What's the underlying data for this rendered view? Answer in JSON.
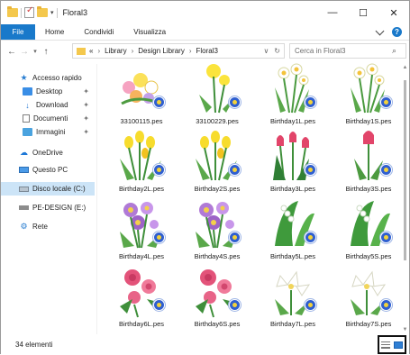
{
  "window": {
    "title": "Floral3",
    "controls": {
      "minimize": "—",
      "maximize": "☐",
      "close": "✕"
    }
  },
  "ribbon": {
    "file": "File",
    "tabs": [
      "Home",
      "Condividi",
      "Visualizza"
    ],
    "expand_icon": "chevron-down-icon",
    "help_icon": "help-icon",
    "help_glyph": "?"
  },
  "address": {
    "back": "←",
    "forward": "→",
    "recent": "▾",
    "up": "↑",
    "overflow": "«",
    "crumbs": [
      "Library",
      "Design Library",
      "Floral3"
    ],
    "separator": "›",
    "dropdown": "∨",
    "refresh": "↻"
  },
  "search": {
    "placeholder": "Cerca in Floral3",
    "icon": "search-icon",
    "glyph": "⌕"
  },
  "navigation": {
    "quick_access": "Accesso rapido",
    "pinned": [
      "Desktop",
      "Download",
      "Documenti",
      "Immagini"
    ],
    "pin_glyph": "✦",
    "onedrive": "OneDrive",
    "this_pc": "Questo PC",
    "local_disk": "Disco locale (C:)",
    "pe_design": "PE-DESIGN (E:)",
    "network": "Rete"
  },
  "files": [
    {
      "name": "33100115.pes",
      "motif": "bouquet"
    },
    {
      "name": "33100229.pes",
      "motif": "dandelion"
    },
    {
      "name": "Birthday1L.pes",
      "motif": "narcissus"
    },
    {
      "name": "Birthday1S.pes",
      "motif": "narcissus"
    },
    {
      "name": "Birthday2L.pes",
      "motif": "freesia"
    },
    {
      "name": "Birthday2S.pes",
      "motif": "freesia"
    },
    {
      "name": "Birthday3L.pes",
      "motif": "tulip"
    },
    {
      "name": "Birthday3S.pes",
      "motif": "tulip-single"
    },
    {
      "name": "Birthday4L.pes",
      "motif": "aster"
    },
    {
      "name": "Birthday4S.pes",
      "motif": "aster"
    },
    {
      "name": "Birthday5L.pes",
      "motif": "lily-of-valley"
    },
    {
      "name": "Birthday5S.pes",
      "motif": "lily-of-valley"
    },
    {
      "name": "Birthday6L.pes",
      "motif": "rose"
    },
    {
      "name": "Birthday6S.pes",
      "motif": "rose"
    },
    {
      "name": "Birthday7L.pes",
      "motif": "white-lily"
    },
    {
      "name": "Birthday7S.pes",
      "motif": "white-lily"
    }
  ],
  "status": {
    "item_count": "34 elementi"
  },
  "colors": {
    "accent": "#1979ca",
    "selection": "#cce4f7",
    "folder": "#f4c84d",
    "badge": "#2f5fd0"
  }
}
